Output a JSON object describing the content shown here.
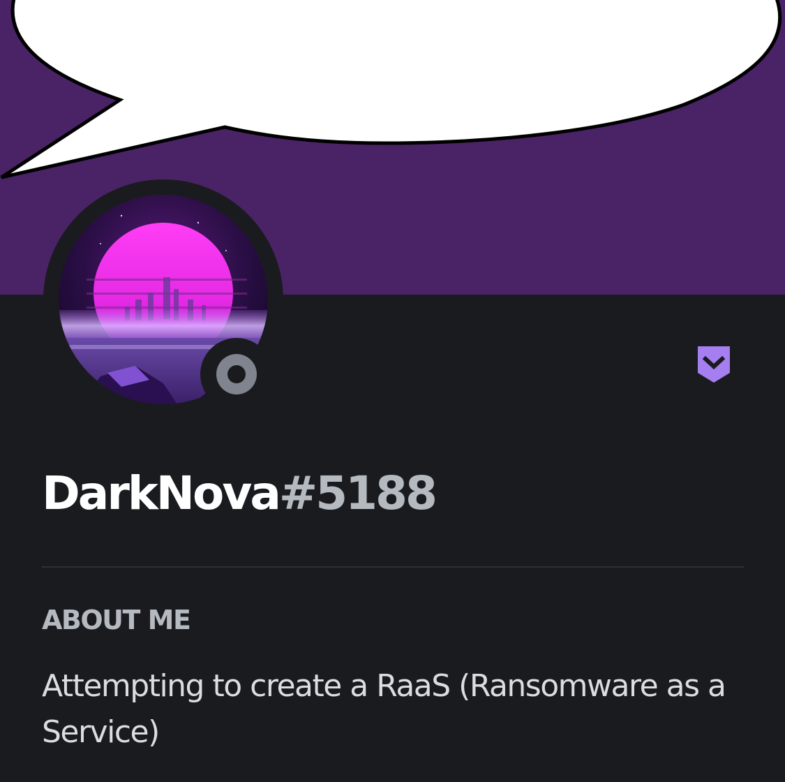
{
  "profile": {
    "username": "DarkNova",
    "discriminator": "#5188",
    "status": "offline",
    "badge_icon": "chevron-badge-icon",
    "avatar_icon": "synthwave-city-avatar"
  },
  "about": {
    "heading": "ABOUT ME",
    "text": "Attempting to create a RaaS (Ransomware as a Service)"
  },
  "colors": {
    "banner": "#4a2366",
    "card_background": "#1a1b1e",
    "status_offline": "#80848e",
    "badge": "#a57ef0",
    "username": "#ffffff",
    "discriminator": "#b5bac1",
    "heading": "#b5bac1",
    "body_text": "#dbdee1"
  }
}
